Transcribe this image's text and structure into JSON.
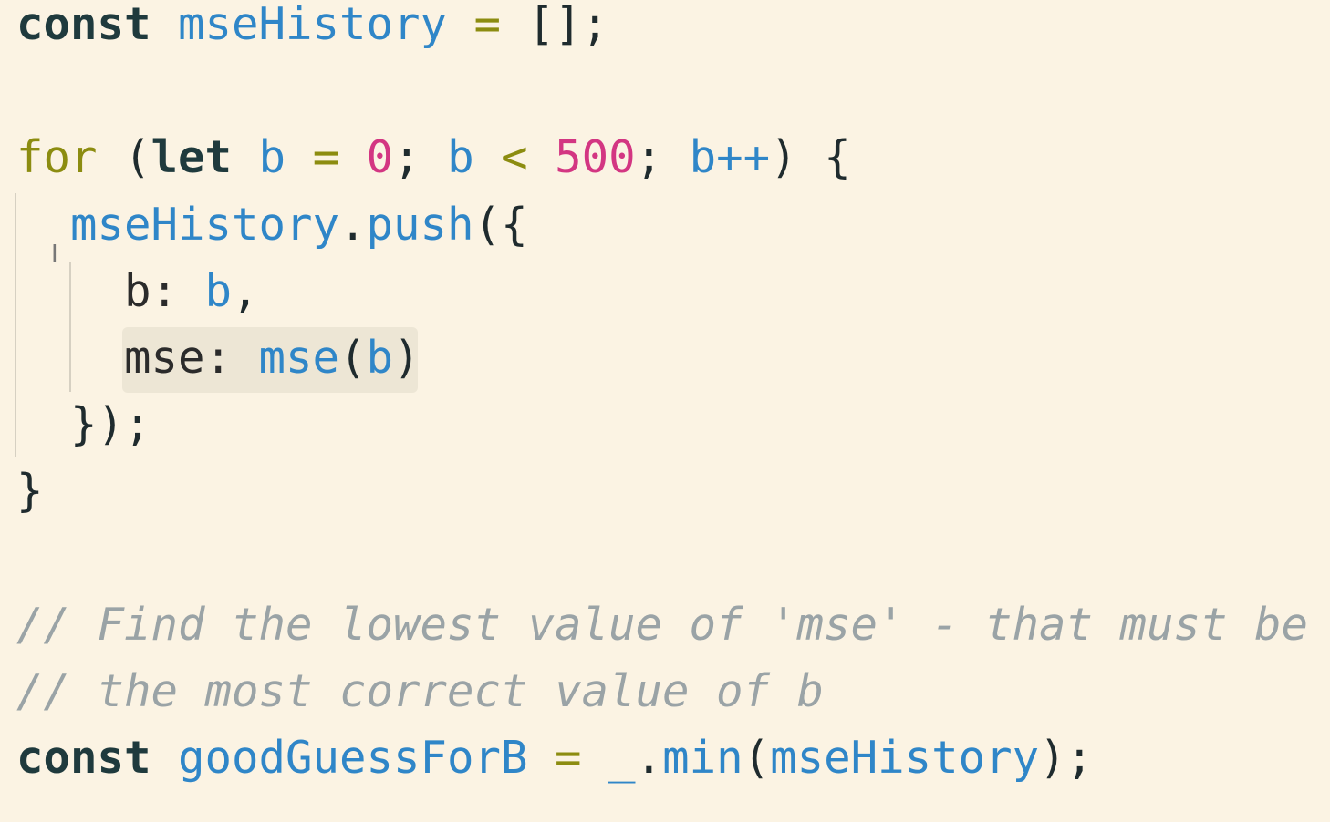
{
  "editor": {
    "background": "#fbf3e3",
    "lines": [
      {
        "tokens": [
          {
            "text": "const ",
            "cls": "kw"
          },
          {
            "text": "mseHistory",
            "cls": "var"
          },
          {
            "text": " = ",
            "cls": "op"
          },
          {
            "text": "[];",
            "cls": "pun"
          }
        ]
      },
      {
        "tokens": []
      },
      {
        "tokens": [
          {
            "text": "for ",
            "cls": "kw-for"
          },
          {
            "text": "(",
            "cls": "pun"
          },
          {
            "text": "let ",
            "cls": "kw"
          },
          {
            "text": "b",
            "cls": "var"
          },
          {
            "text": " = ",
            "cls": "op"
          },
          {
            "text": "0",
            "cls": "num"
          },
          {
            "text": "; ",
            "cls": "pun"
          },
          {
            "text": "b",
            "cls": "var"
          },
          {
            "text": " < ",
            "cls": "op"
          },
          {
            "text": "500",
            "cls": "num"
          },
          {
            "text": "; ",
            "cls": "pun"
          },
          {
            "text": "b++",
            "cls": "var"
          },
          {
            "text": ") {",
            "cls": "pun"
          }
        ]
      },
      {
        "tokens": [
          {
            "text": "  ",
            "cls": "plain"
          },
          {
            "text": "mseHistory",
            "cls": "var"
          },
          {
            "text": ".",
            "cls": "pun"
          },
          {
            "text": "push",
            "cls": "var"
          },
          {
            "text": "({",
            "cls": "pun"
          }
        ]
      },
      {
        "tokens": [
          {
            "text": "    b: ",
            "cls": "plain"
          },
          {
            "text": "b",
            "cls": "var"
          },
          {
            "text": ",",
            "cls": "pun"
          }
        ]
      },
      {
        "tokens": [
          {
            "text": "    mse: ",
            "cls": "plain"
          },
          {
            "text": "mse",
            "cls": "var"
          },
          {
            "text": "(",
            "cls": "pun"
          },
          {
            "text": "b",
            "cls": "var"
          },
          {
            "text": ")",
            "cls": "pun"
          }
        ]
      },
      {
        "tokens": [
          {
            "text": "  });",
            "cls": "pun"
          }
        ]
      },
      {
        "tokens": [
          {
            "text": "}",
            "cls": "pun"
          }
        ]
      },
      {
        "tokens": []
      },
      {
        "tokens": [
          {
            "text": "// Find the lowest value of 'mse' - that must be",
            "cls": "com"
          }
        ]
      },
      {
        "tokens": [
          {
            "text": "// the most correct value of b",
            "cls": "com"
          }
        ]
      },
      {
        "tokens": [
          {
            "text": "const ",
            "cls": "kw"
          },
          {
            "text": "goodGuessForB",
            "cls": "var"
          },
          {
            "text": " = ",
            "cls": "op"
          },
          {
            "text": "_",
            "cls": "var"
          },
          {
            "text": ".",
            "cls": "pun"
          },
          {
            "text": "min",
            "cls": "var"
          },
          {
            "text": "(",
            "cls": "pun"
          },
          {
            "text": "mseHistory",
            "cls": "var"
          },
          {
            "text": ");",
            "cls": "pun"
          }
        ]
      }
    ]
  },
  "cursor": {
    "icon": "text-cursor-icon",
    "glyph": "I"
  }
}
